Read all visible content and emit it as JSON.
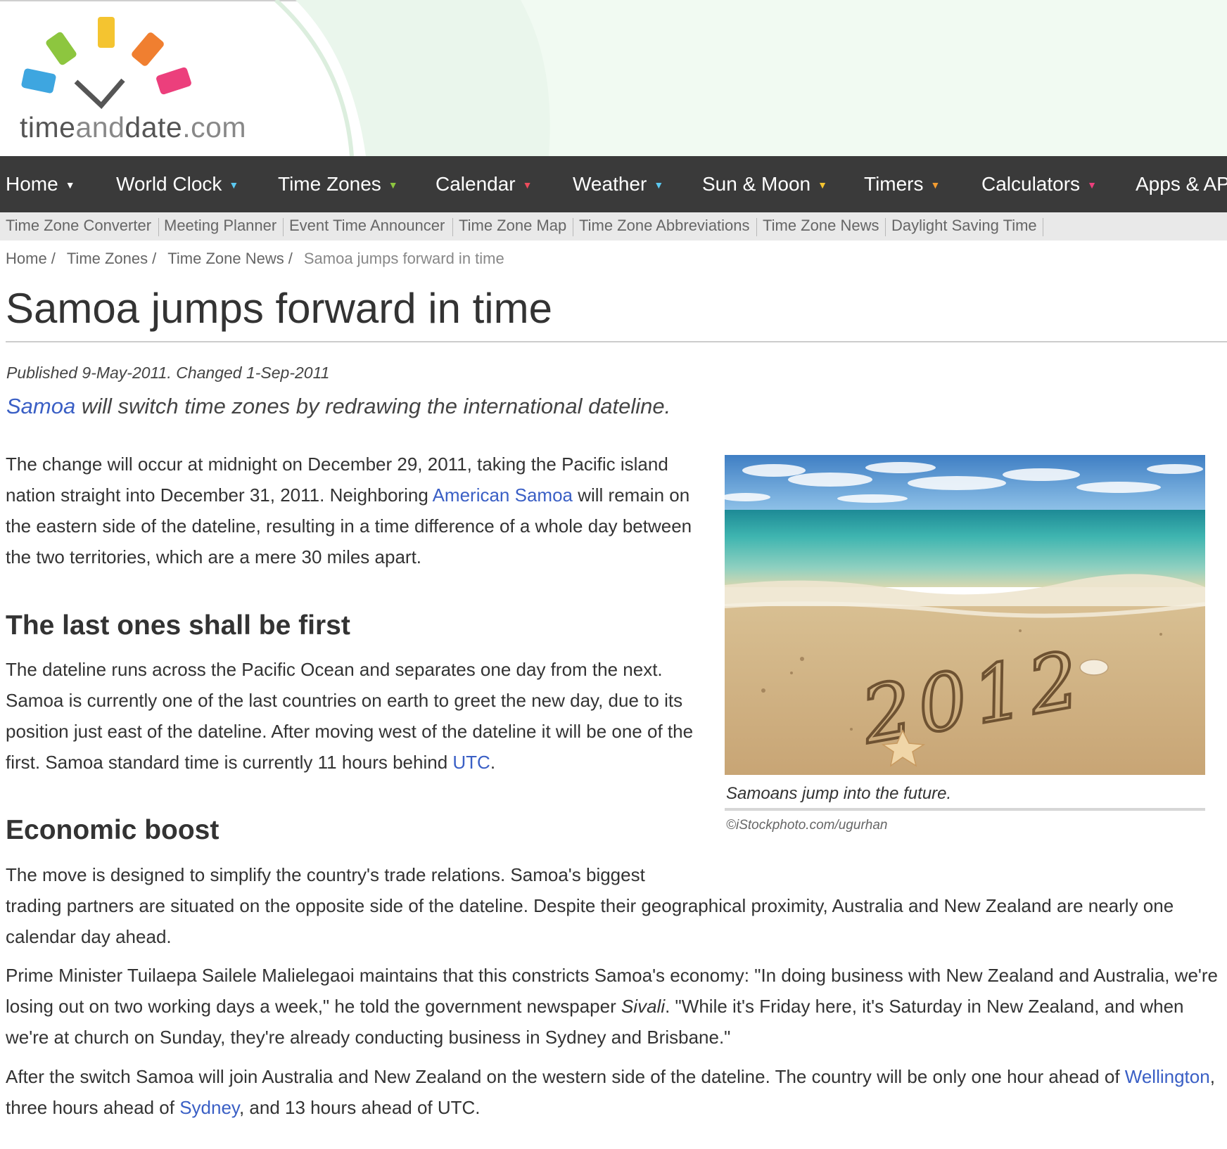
{
  "site": {
    "logo": {
      "text_a": "time",
      "text_b": "and",
      "text_c": "date",
      "text_d": ".com"
    },
    "colors": {
      "nav_bg": "#3a3a3a",
      "subnav_bg": "#e9e9e9",
      "link": "#3a5fc5",
      "header_green": "#eaf6ec"
    }
  },
  "nav": {
    "items": [
      {
        "label": "Home",
        "caret_color": "#ffffff"
      },
      {
        "label": "World Clock",
        "caret_color": "#5bc8f0"
      },
      {
        "label": "Time Zones",
        "caret_color": "#8dc63f"
      },
      {
        "label": "Calendar",
        "caret_color": "#ec4c5c"
      },
      {
        "label": "Weather",
        "caret_color": "#5bc8f0"
      },
      {
        "label": "Sun & Moon",
        "caret_color": "#f4c430"
      },
      {
        "label": "Timers",
        "caret_color": "#f29b30"
      },
      {
        "label": "Calculators",
        "caret_color": "#ec3f7c"
      },
      {
        "label": "Apps & AP",
        "caret_color": "#ffffff"
      }
    ]
  },
  "subnav": {
    "items": [
      "Time Zone Converter",
      "Meeting Planner",
      "Event Time Announcer",
      "Time Zone Map",
      "Time Zone Abbreviations",
      "Time Zone News",
      "Daylight Saving Time"
    ]
  },
  "breadcrumb": {
    "items": [
      "Home",
      "Time Zones",
      "Time Zone News"
    ],
    "separator": "/",
    "current": "Samoa jumps forward in time"
  },
  "article": {
    "title": "Samoa jumps forward in time",
    "published": "Published 9-May-2011. Changed 1-Sep-2011",
    "lead": {
      "link": "Samoa",
      "text": " will switch time zones by redrawing the international dateline."
    },
    "p1": {
      "a": "The change will occur at midnight on December 29, 2011, taking the Pacific island nation straight into December 31, 2011. Neighboring ",
      "link": "American Samoa",
      "b": " will remain on the eastern side of the dateline, resulting in a time difference of a whole day between the two territories, which are a mere 30 miles apart."
    },
    "h2_1": "The last ones shall be first",
    "p2": {
      "a": "The dateline runs across the Pacific Ocean and separates one day from the next. Samoa is currently one of the last countries on earth to greet the new day, due to its position just east of the dateline. After moving west of the dateline it will be one of the first. Samoa standard time is currently 11 hours behind ",
      "link": "UTC",
      "b": "."
    },
    "h2_2": "Economic boost",
    "p3": {
      "a": "The move is designed to simplify the country's trade relations. Samoa's biggest",
      "b": "trading partners are situated on the opposite side of the dateline. Despite their geographical proximity, Australia and New Zealand are nearly one calendar day ahead."
    },
    "p4": {
      "a": "Prime Minister Tuilaepa Sailele Malielegaoi maintains that this constricts Samoa's economy: \"In doing business with New Zealand and Australia, we're losing out on two working days a week,\" he told the government newspaper ",
      "em": "Sivali",
      "b": ". \"While it's Friday here, it's Saturday in New Zealand, and when we're at church on Sunday, they're already conducting business in Sydney and Brisbane.\""
    },
    "p5": {
      "a": "After the switch Samoa will join Australia and New Zealand on the western side of the dateline. The country will be only one hour ahead of ",
      "link1": "Wellington",
      "b": ", three hours ahead of ",
      "link2": "Sydney",
      "c": ", and 13 hours ahead of UTC."
    }
  },
  "figure": {
    "sand_text": "2012",
    "caption": "Samoans jump into the future.",
    "credit": "©iStockphoto.com/ugurhan"
  }
}
